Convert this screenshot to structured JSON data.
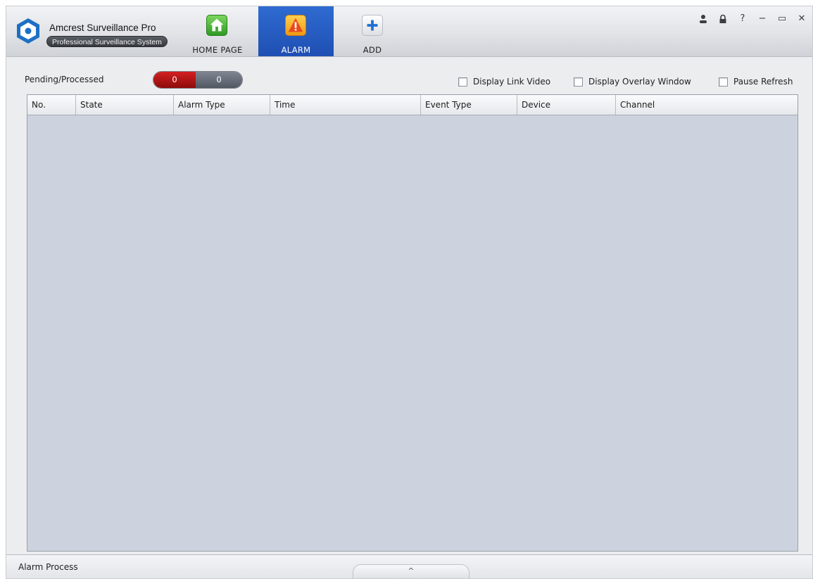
{
  "app": {
    "name": "Amcrest Surveillance Pro",
    "subtitle": "Professional Surveillance System"
  },
  "nav": {
    "tabs": [
      {
        "label": "HOME PAGE",
        "icon": "home-icon",
        "active": false
      },
      {
        "label": "ALARM",
        "icon": "alarm-warning-icon",
        "active": true
      },
      {
        "label": "ADD",
        "icon": "plus-icon",
        "active": false
      }
    ]
  },
  "window_controls": {
    "user": "♙",
    "lock": "▲",
    "help": "?",
    "minimize": "−",
    "maximize": "▭",
    "close": "✕"
  },
  "toolbar": {
    "pending_processed_label": "Pending/Processed",
    "pending_count": "0",
    "processed_count": "0",
    "options": {
      "display_link_video": {
        "label": "Display Link Video",
        "checked": false
      },
      "display_overlay_window": {
        "label": "Display Overlay Window",
        "checked": false
      },
      "pause_refresh": {
        "label": "Pause Refresh",
        "checked": false
      }
    }
  },
  "table": {
    "columns": [
      "No.",
      "State",
      "Alarm Type",
      "Time",
      "Event Type",
      "Device",
      "Channel"
    ],
    "rows": []
  },
  "statusbar": {
    "alarm_process_label": "Alarm Process",
    "expand_glyph": "^"
  },
  "colors": {
    "accent_blue": "#2f6bd1",
    "pending_red": "#c41616",
    "processed_gray": "#6a717c",
    "table_bg": "#ccd3de"
  }
}
